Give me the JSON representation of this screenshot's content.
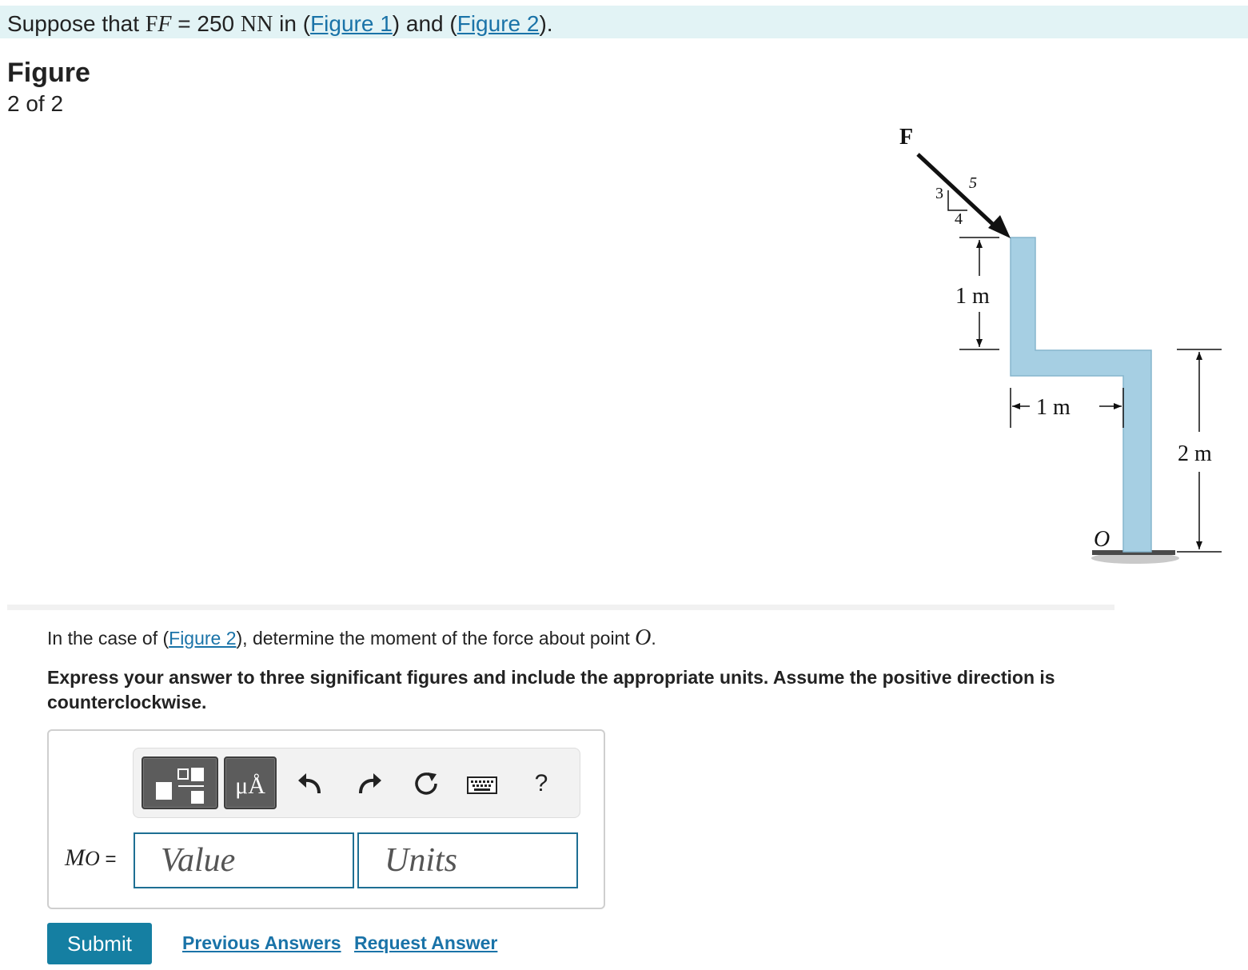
{
  "intro": {
    "prefix": "Suppose that ",
    "var_symbol": "F",
    "var_symbol_italic": "F",
    "equals": " = 250 ",
    "unit_a": "N",
    "unit_b": "N",
    "mid": " in (",
    "link1": "Figure 1",
    "and": ") and (",
    "link2": "Figure 2",
    "end": ")."
  },
  "figure": {
    "title": "Figure",
    "counter": "2 of 2",
    "labels": {
      "force": "F",
      "slope_3": "3",
      "slope_4": "4",
      "slope_5": "5",
      "dim_top": "1 m",
      "dim_mid": "1 m",
      "dim_right": "2 m",
      "point": "O"
    }
  },
  "question": {
    "prefix": "In the case of (",
    "link": "Figure 2",
    "suffix": "), determine the moment of the force about point ",
    "point": "O",
    "end": "."
  },
  "instructions": "Express your answer to three significant figures and include the appropriate units. Assume the positive direction is counterclockwise.",
  "answer": {
    "label_var": "M",
    "label_sub": "O",
    "label_eq": " =",
    "value_placeholder": "Value",
    "units_placeholder": "Units",
    "toolbar": {
      "units_glyph": "μÅ",
      "help_glyph": "?"
    }
  },
  "actions": {
    "submit": "Submit",
    "previous_answers": "Previous Answers",
    "request_answer": "Request Answer"
  },
  "colors": {
    "banner": "#e2f3f5",
    "link": "#1a73a8",
    "submit_bg": "#157fa2",
    "member_fill": "#a6cfe3"
  }
}
